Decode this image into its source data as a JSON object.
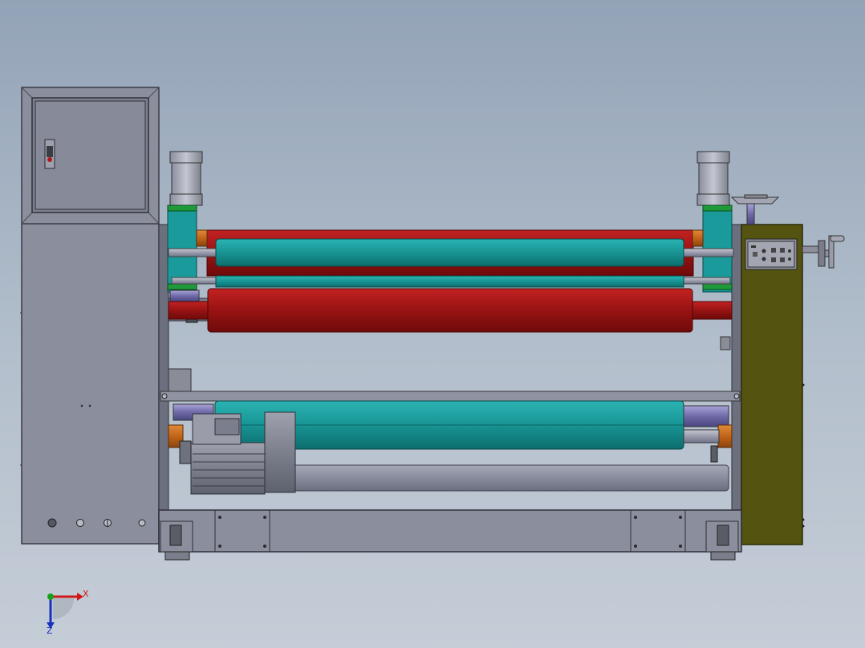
{
  "axes": {
    "x_label": "X",
    "z_label": "Z",
    "colors": {
      "x": "#d01818",
      "y": "#18a018",
      "z": "#1830c0"
    }
  },
  "colors": {
    "frame": "#8a8f9c",
    "cabinet": "#8b8e9c",
    "drive_box": "#545410",
    "red_roller": "#a81818",
    "cyan_roller": "#1a9a9a",
    "grey_roller": "#8a8ea0",
    "green_band": "#1f9a3a",
    "orange_bearing": "#c86a20"
  }
}
